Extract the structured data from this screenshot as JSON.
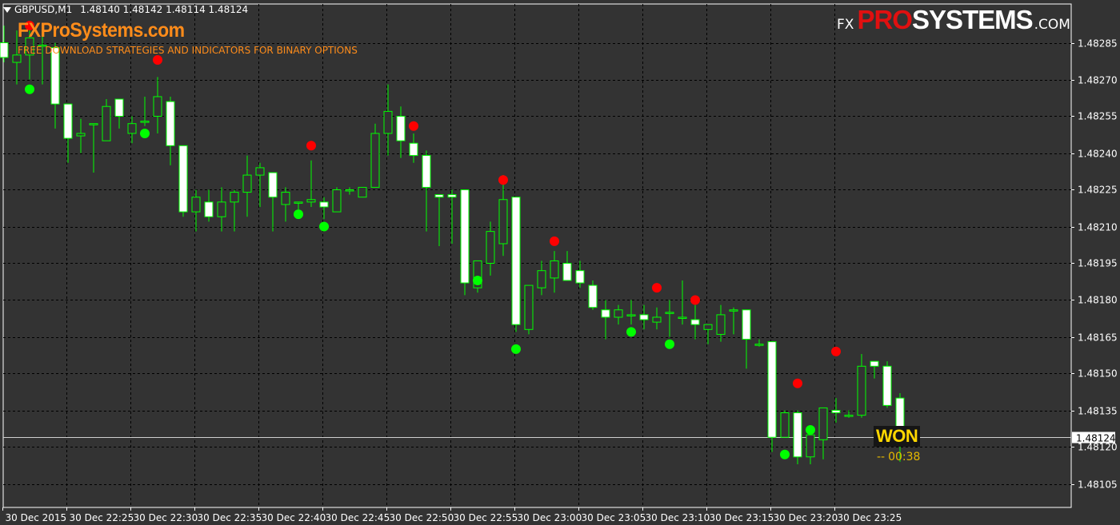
{
  "header": {
    "symbol": "GBPUSD,M1",
    "ohlc": "1.48140 1.48142 1.48114 1.48124"
  },
  "watermark": {
    "site": "FXProSystems.com",
    "tagline": "FREE DOWNLOAD STRATEGIES AND INDICATORS FOR BINARY OPTIONS"
  },
  "logo": {
    "prefix": "FX",
    "pro": "PRO",
    "systems": "SYSTEMS",
    "domain": ".COM"
  },
  "status": {
    "result": "WON",
    "dash": "--",
    "countdown": "00:38"
  },
  "colors": {
    "background": "#333333",
    "grid": "#000000",
    "bull_body": "#333333",
    "bear_body": "#ffffff",
    "wick": "#00ff00",
    "sell_dot": "#ff0000",
    "buy_dot": "#00ff00",
    "axis_text": "#ffffff",
    "won_text": "#ffd700"
  },
  "chart_data": {
    "type": "candlestick",
    "symbol": "GBPUSD",
    "timeframe": "M1",
    "ylim": [
      1.481,
      1.4829
    ],
    "y_ticks": [
      "1.48285",
      "1.48270",
      "1.48255",
      "1.48240",
      "1.48225",
      "1.48210",
      "1.48195",
      "1.48180",
      "1.48165",
      "1.48150",
      "1.48135",
      "1.48120",
      "1.48105"
    ],
    "x_ticks": [
      {
        "index": 0,
        "label": "30 Dec 2015"
      },
      {
        "index": 5,
        "label": "30 Dec 22:25"
      },
      {
        "index": 10,
        "label": "30 Dec 22:30"
      },
      {
        "index": 15,
        "label": "30 Dec 22:35"
      },
      {
        "index": 20,
        "label": "30 Dec 22:40"
      },
      {
        "index": 25,
        "label": "30 Dec 22:45"
      },
      {
        "index": 30,
        "label": "30 Dec 22:50"
      },
      {
        "index": 35,
        "label": "30 Dec 22:55"
      },
      {
        "index": 40,
        "label": "30 Dec 23:00"
      },
      {
        "index": 45,
        "label": "30 Dec 23:05"
      },
      {
        "index": 50,
        "label": "30 Dec 23:10"
      },
      {
        "index": 55,
        "label": "30 Dec 23:15"
      },
      {
        "index": 60,
        "label": "30 Dec 23:20"
      },
      {
        "index": 65,
        "label": "30 Dec 23:25"
      }
    ],
    "current_price": "1.48124",
    "candles": [
      {
        "o": 1.48285,
        "h": 1.48292,
        "l": 1.48277,
        "c": 1.48279
      },
      {
        "o": 1.48277,
        "h": 1.4829,
        "l": 1.48268,
        "c": 1.4828
      },
      {
        "o": 1.4828,
        "h": 1.48292,
        "l": 1.4827,
        "c": 1.48287
      },
      {
        "o": 1.48284,
        "h": 1.48292,
        "l": 1.48268,
        "c": 1.48284
      },
      {
        "o": 1.48283,
        "h": 1.48285,
        "l": 1.4825,
        "c": 1.4826
      },
      {
        "o": 1.4826,
        "h": 1.4826,
        "l": 1.48236,
        "c": 1.48246
      },
      {
        "o": 1.48247,
        "h": 1.48254,
        "l": 1.4824,
        "c": 1.48248
      },
      {
        "o": 1.48252,
        "h": 1.48252,
        "l": 1.48232,
        "c": 1.48252
      },
      {
        "o": 1.48245,
        "h": 1.48262,
        "l": 1.48245,
        "c": 1.48259
      },
      {
        "o": 1.48262,
        "h": 1.48262,
        "l": 1.4825,
        "c": 1.48255
      },
      {
        "o": 1.48248,
        "h": 1.48255,
        "l": 1.48244,
        "c": 1.48252
      },
      {
        "o": 1.48253,
        "h": 1.48263,
        "l": 1.48251,
        "c": 1.48253
      },
      {
        "o": 1.48255,
        "h": 1.48271,
        "l": 1.48248,
        "c": 1.48263
      },
      {
        "o": 1.48261,
        "h": 1.48263,
        "l": 1.48235,
        "c": 1.48243
      },
      {
        "o": 1.48243,
        "h": 1.48243,
        "l": 1.48214,
        "c": 1.48216
      },
      {
        "o": 1.48216,
        "h": 1.48225,
        "l": 1.48208,
        "c": 1.48222
      },
      {
        "o": 1.4822,
        "h": 1.48225,
        "l": 1.48212,
        "c": 1.48214
      },
      {
        "o": 1.48214,
        "h": 1.48226,
        "l": 1.48208,
        "c": 1.4822
      },
      {
        "o": 1.4822,
        "h": 1.48225,
        "l": 1.48208,
        "c": 1.48224
      },
      {
        "o": 1.48224,
        "h": 1.48239,
        "l": 1.48214,
        "c": 1.48231
      },
      {
        "o": 1.48231,
        "h": 1.48236,
        "l": 1.48218,
        "c": 1.48234
      },
      {
        "o": 1.48232,
        "h": 1.48232,
        "l": 1.48208,
        "c": 1.48222
      },
      {
        "o": 1.48219,
        "h": 1.48226,
        "l": 1.48212,
        "c": 1.48224
      },
      {
        "o": 1.4822,
        "h": 1.4822,
        "l": 1.48217,
        "c": 1.4822
      },
      {
        "o": 1.4822,
        "h": 1.48237,
        "l": 1.48218,
        "c": 1.48221
      },
      {
        "o": 1.4822,
        "h": 1.48222,
        "l": 1.48213,
        "c": 1.48218
      },
      {
        "o": 1.48216,
        "h": 1.48226,
        "l": 1.48216,
        "c": 1.48225
      },
      {
        "o": 1.48225,
        "h": 1.48226,
        "l": 1.48223,
        "c": 1.48225
      },
      {
        "o": 1.48222,
        "h": 1.48226,
        "l": 1.48222,
        "c": 1.48226
      },
      {
        "o": 1.48226,
        "h": 1.48252,
        "l": 1.48226,
        "c": 1.48248
      },
      {
        "o": 1.48248,
        "h": 1.48268,
        "l": 1.48239,
        "c": 1.48257
      },
      {
        "o": 1.48255,
        "h": 1.48259,
        "l": 1.48238,
        "c": 1.48245
      },
      {
        "o": 1.48244,
        "h": 1.48248,
        "l": 1.48236,
        "c": 1.48239
      },
      {
        "o": 1.48239,
        "h": 1.48241,
        "l": 1.48208,
        "c": 1.48226
      },
      {
        "o": 1.48223,
        "h": 1.48223,
        "l": 1.48202,
        "c": 1.48222
      },
      {
        "o": 1.48223,
        "h": 1.48225,
        "l": 1.48203,
        "c": 1.48222
      },
      {
        "o": 1.48225,
        "h": 1.48225,
        "l": 1.48182,
        "c": 1.48187
      },
      {
        "o": 1.48185,
        "h": 1.48196,
        "l": 1.48183,
        "c": 1.48196
      },
      {
        "o": 1.48195,
        "h": 1.48212,
        "l": 1.4819,
        "c": 1.48208
      },
      {
        "o": 1.48203,
        "h": 1.48231,
        "l": 1.48198,
        "c": 1.48221
      },
      {
        "o": 1.48222,
        "h": 1.48222,
        "l": 1.48167,
        "c": 1.4817
      },
      {
        "o": 1.48168,
        "h": 1.48186,
        "l": 1.48166,
        "c": 1.48186
      },
      {
        "o": 1.48185,
        "h": 1.48196,
        "l": 1.48182,
        "c": 1.48192
      },
      {
        "o": 1.48189,
        "h": 1.482,
        "l": 1.48183,
        "c": 1.48196
      },
      {
        "o": 1.48195,
        "h": 1.482,
        "l": 1.48188,
        "c": 1.48188
      },
      {
        "o": 1.48192,
        "h": 1.48196,
        "l": 1.48185,
        "c": 1.48187
      },
      {
        "o": 1.48186,
        "h": 1.48188,
        "l": 1.48176,
        "c": 1.48177
      },
      {
        "o": 1.48176,
        "h": 1.4818,
        "l": 1.48164,
        "c": 1.48173
      },
      {
        "o": 1.48173,
        "h": 1.48178,
        "l": 1.4817,
        "c": 1.48176
      },
      {
        "o": 1.48174,
        "h": 1.4818,
        "l": 1.4817,
        "c": 1.48174
      },
      {
        "o": 1.48174,
        "h": 1.48178,
        "l": 1.48168,
        "c": 1.48172
      },
      {
        "o": 1.48171,
        "h": 1.48177,
        "l": 1.48168,
        "c": 1.48173
      },
      {
        "o": 1.48175,
        "h": 1.4818,
        "l": 1.48165,
        "c": 1.48175
      },
      {
        "o": 1.48173,
        "h": 1.48188,
        "l": 1.4817,
        "c": 1.48173
      },
      {
        "o": 1.48172,
        "h": 1.48178,
        "l": 1.48164,
        "c": 1.4817
      },
      {
        "o": 1.48168,
        "h": 1.4817,
        "l": 1.48162,
        "c": 1.4817
      },
      {
        "o": 1.48166,
        "h": 1.48178,
        "l": 1.48163,
        "c": 1.48174
      },
      {
        "o": 1.48176,
        "h": 1.48177,
        "l": 1.48166,
        "c": 1.48176
      },
      {
        "o": 1.48176,
        "h": 1.48176,
        "l": 1.48152,
        "c": 1.48164
      },
      {
        "o": 1.48162,
        "h": 1.48164,
        "l": 1.48161,
        "c": 1.48162
      },
      {
        "o": 1.48163,
        "h": 1.48163,
        "l": 1.48118,
        "c": 1.48124
      },
      {
        "o": 1.48124,
        "h": 1.48135,
        "l": 1.48124,
        "c": 1.48134
      },
      {
        "o": 1.48134,
        "h": 1.48135,
        "l": 1.48113,
        "c": 1.48116
      },
      {
        "o": 1.48116,
        "h": 1.48126,
        "l": 1.48113,
        "c": 1.48125
      },
      {
        "o": 1.48123,
        "h": 1.48136,
        "l": 1.48115,
        "c": 1.48136
      },
      {
        "o": 1.48135,
        "h": 1.4814,
        "l": 1.4813,
        "c": 1.48134
      },
      {
        "o": 1.48133,
        "h": 1.48135,
        "l": 1.48132,
        "c": 1.48133
      },
      {
        "o": 1.48133,
        "h": 1.48158,
        "l": 1.48132,
        "c": 1.48153
      },
      {
        "o": 1.48155,
        "h": 1.48155,
        "l": 1.48148,
        "c": 1.48153
      },
      {
        "o": 1.48153,
        "h": 1.48155,
        "l": 1.48136,
        "c": 1.48137
      },
      {
        "o": 1.4814,
        "h": 1.48142,
        "l": 1.48114,
        "c": 1.48124
      }
    ],
    "sell_signals": [
      {
        "index": 2,
        "price": 1.48292
      },
      {
        "index": 12,
        "price": 1.48278
      },
      {
        "index": 24,
        "price": 1.48243
      },
      {
        "index": 32,
        "price": 1.48251
      },
      {
        "index": 39,
        "price": 1.48229
      },
      {
        "index": 43,
        "price": 1.48204
      },
      {
        "index": 51,
        "price": 1.48185
      },
      {
        "index": 54,
        "price": 1.4818
      },
      {
        "index": 62,
        "price": 1.48146
      },
      {
        "index": 65,
        "price": 1.48159
      }
    ],
    "buy_signals": [
      {
        "index": 2,
        "price": 1.48266
      },
      {
        "index": 11,
        "price": 1.48248
      },
      {
        "index": 23,
        "price": 1.48215
      },
      {
        "index": 25,
        "price": 1.4821
      },
      {
        "index": 37,
        "price": 1.48188
      },
      {
        "index": 40,
        "price": 1.4816
      },
      {
        "index": 49,
        "price": 1.48167
      },
      {
        "index": 52,
        "price": 1.48162
      },
      {
        "index": 61,
        "price": 1.48117
      },
      {
        "index": 63,
        "price": 1.48127
      }
    ]
  }
}
